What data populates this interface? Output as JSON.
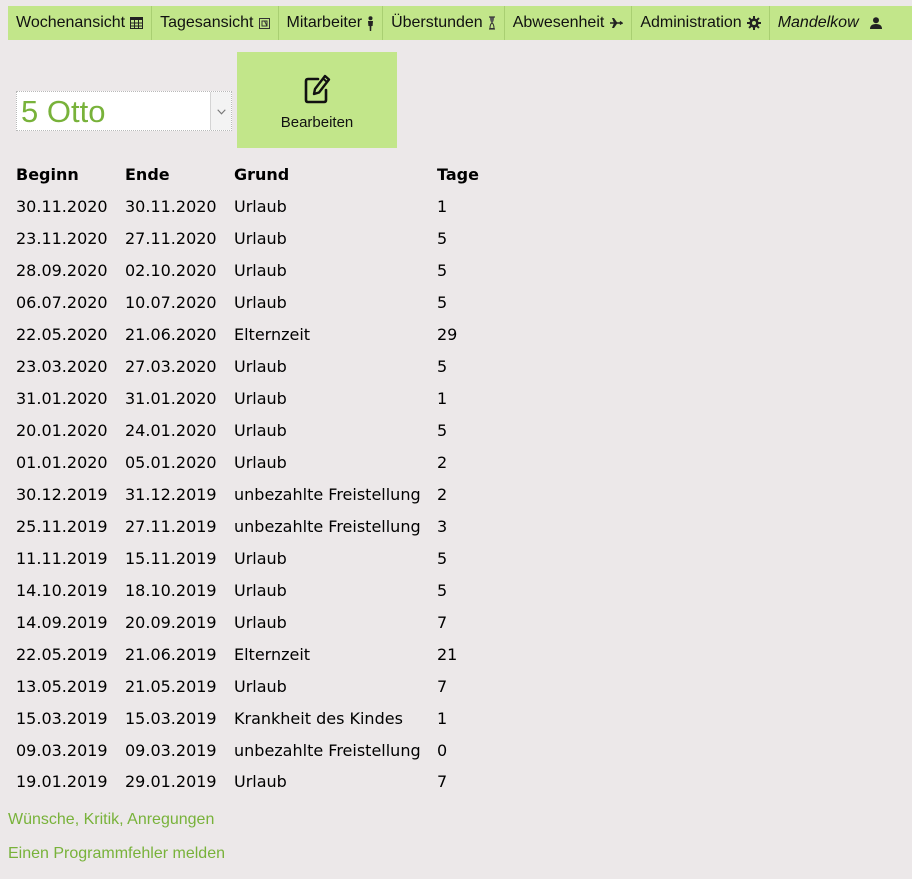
{
  "nav": {
    "items": [
      {
        "label": "Wochenansicht",
        "icon": "calendar-grid-icon"
      },
      {
        "label": "Tagesansicht",
        "icon": "day-calendar-icon"
      },
      {
        "label": "Mitarbeiter",
        "icon": "person-icon"
      },
      {
        "label": "Überstunden",
        "icon": "hourglass-icon"
      },
      {
        "label": "Abwesenheit",
        "icon": "plane-icon"
      },
      {
        "label": "Administration",
        "icon": "gear-icon"
      }
    ],
    "user": {
      "label": "Mandelkow",
      "icon": "user-icon"
    }
  },
  "employee_select": {
    "value": "5 Otto"
  },
  "edit_button": {
    "label": "Bearbeiten",
    "icon": "edit-icon"
  },
  "table": {
    "headers": {
      "begin": "Beginn",
      "end": "Ende",
      "reason": "Grund",
      "days": "Tage"
    },
    "rows": [
      {
        "begin": "30.11.2020",
        "end": "30.11.2020",
        "reason": "Urlaub",
        "days": "1"
      },
      {
        "begin": "23.11.2020",
        "end": "27.11.2020",
        "reason": "Urlaub",
        "days": "5"
      },
      {
        "begin": "28.09.2020",
        "end": "02.10.2020",
        "reason": "Urlaub",
        "days": "5"
      },
      {
        "begin": "06.07.2020",
        "end": "10.07.2020",
        "reason": "Urlaub",
        "days": "5"
      },
      {
        "begin": "22.05.2020",
        "end": "21.06.2020",
        "reason": "Elternzeit",
        "days": "29"
      },
      {
        "begin": "23.03.2020",
        "end": "27.03.2020",
        "reason": "Urlaub",
        "days": "5"
      },
      {
        "begin": "31.01.2020",
        "end": "31.01.2020",
        "reason": "Urlaub",
        "days": "1"
      },
      {
        "begin": "20.01.2020",
        "end": "24.01.2020",
        "reason": "Urlaub",
        "days": "5"
      },
      {
        "begin": "01.01.2020",
        "end": "05.01.2020",
        "reason": "Urlaub",
        "days": "2"
      },
      {
        "begin": "30.12.2019",
        "end": "31.12.2019",
        "reason": "unbezahlte Freistellung",
        "days": "2"
      },
      {
        "begin": "25.11.2019",
        "end": "27.11.2019",
        "reason": "unbezahlte Freistellung",
        "days": "3"
      },
      {
        "begin": "11.11.2019",
        "end": "15.11.2019",
        "reason": "Urlaub",
        "days": "5"
      },
      {
        "begin": "14.10.2019",
        "end": "18.10.2019",
        "reason": "Urlaub",
        "days": "5"
      },
      {
        "begin": "14.09.2019",
        "end": "20.09.2019",
        "reason": "Urlaub",
        "days": "7"
      },
      {
        "begin": "22.05.2019",
        "end": "21.06.2019",
        "reason": "Elternzeit",
        "days": "21"
      },
      {
        "begin": "13.05.2019",
        "end": "21.05.2019",
        "reason": "Urlaub",
        "days": "7"
      },
      {
        "begin": "15.03.2019",
        "end": "15.03.2019",
        "reason": "Krankheit des Kindes",
        "days": "1"
      },
      {
        "begin": "09.03.2019",
        "end": "09.03.2019",
        "reason": "unbezahlte Freistellung",
        "days": "0"
      },
      {
        "begin": "19.01.2019",
        "end": "29.01.2019",
        "reason": "Urlaub",
        "days": "7"
      }
    ]
  },
  "footer": {
    "feedback": "Wünsche, Kritik, Anregungen",
    "bug_report": "Einen Programmfehler melden"
  },
  "colors": {
    "nav_bg": "#c2e68a",
    "page_bg": "#ece8e9",
    "accent_text": "#78b23a"
  }
}
